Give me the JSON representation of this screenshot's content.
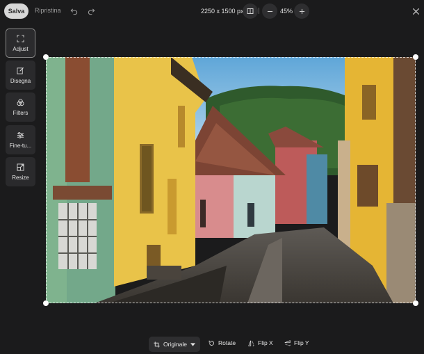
{
  "toolbar": {
    "save_label": "Salva",
    "reset_label": "Ripristina",
    "undo_icon": "undo-icon",
    "redo_icon": "redo-icon",
    "dimensions": "2250 x 1500 px",
    "zoom_level": "45%",
    "close_icon": "close-icon"
  },
  "tools": [
    {
      "label": "Adjust",
      "icon": "crop-icon",
      "active": true
    },
    {
      "label": "Disegna",
      "icon": "pencil-icon",
      "active": false
    },
    {
      "label": "Filters",
      "icon": "filters-icon",
      "active": false
    },
    {
      "label": "Fine-tu...",
      "icon": "sliders-icon",
      "active": false
    },
    {
      "label": "Resize",
      "icon": "resize-icon",
      "active": false
    }
  ],
  "bottom": {
    "aspect_label": "Originale",
    "rotate_label": "Rotate",
    "flip_x_label": "Flip X",
    "flip_y_label": "Flip Y"
  },
  "colors": {
    "background": "#1b1b1c",
    "panel": "#2a2a2c",
    "save_button": "#d7d7d7"
  }
}
